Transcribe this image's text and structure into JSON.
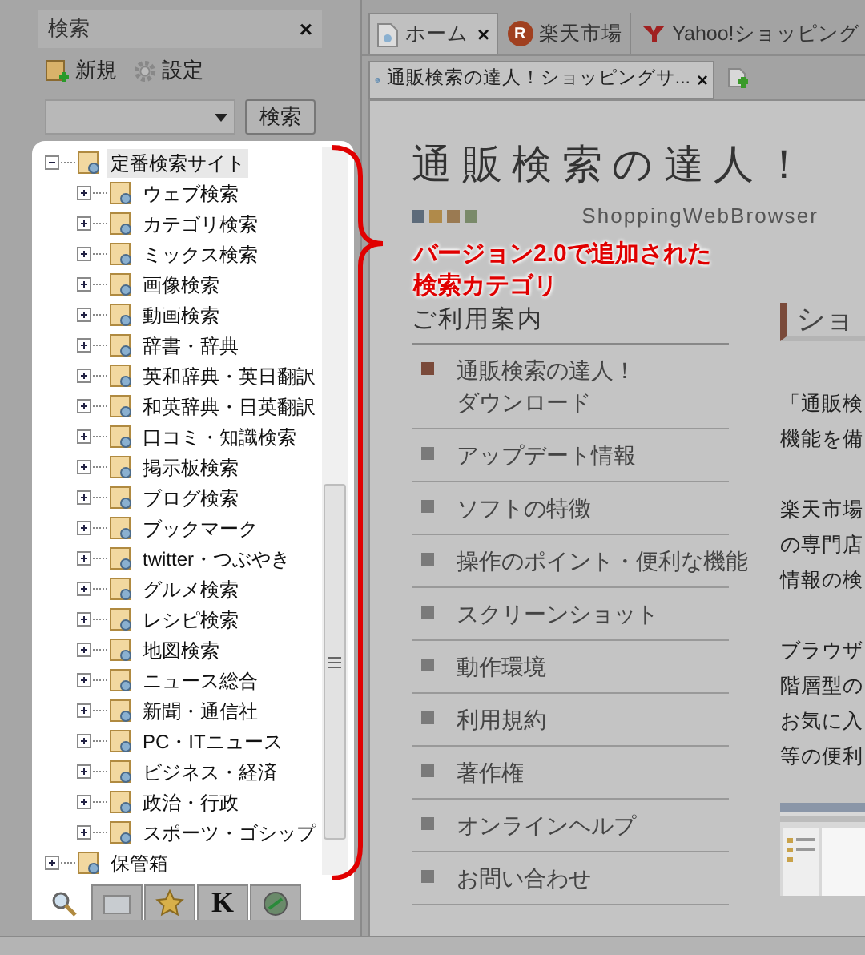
{
  "sidebar": {
    "title": "検索",
    "close": "×",
    "toolbar": [
      {
        "label": "新規",
        "kind": "new"
      },
      {
        "label": "設定",
        "kind": "settings"
      }
    ],
    "search_button": "検索",
    "tree": [
      {
        "label": "定番検索サイト",
        "expanded": true,
        "selected": true,
        "children": [
          {
            "label": "ウェブ検索",
            "expanded": false,
            "selected": false
          },
          {
            "label": "カテゴリ検索",
            "expanded": false,
            "selected": false
          },
          {
            "label": "ミックス検索",
            "expanded": false,
            "selected": false
          },
          {
            "label": "画像検索",
            "expanded": false,
            "selected": false
          },
          {
            "label": "動画検索",
            "expanded": false,
            "selected": false
          },
          {
            "label": "辞書・辞典",
            "expanded": false,
            "selected": false
          },
          {
            "label": "英和辞典・英日翻訳",
            "expanded": false,
            "selected": false
          },
          {
            "label": "和英辞典・日英翻訳",
            "expanded": false,
            "selected": false
          },
          {
            "label": "口コミ・知識検索",
            "expanded": false,
            "selected": false
          },
          {
            "label": "掲示板検索",
            "expanded": false,
            "selected": false
          },
          {
            "label": "ブログ検索",
            "expanded": false,
            "selected": false
          },
          {
            "label": "ブックマーク",
            "expanded": false,
            "selected": false
          },
          {
            "label": "twitter・つぶやき",
            "expanded": false,
            "selected": false
          },
          {
            "label": "グルメ検索",
            "expanded": false,
            "selected": false
          },
          {
            "label": "レシピ検索",
            "expanded": false,
            "selected": false
          },
          {
            "label": "地図検索",
            "expanded": false,
            "selected": false
          },
          {
            "label": "ニュース総合",
            "expanded": false,
            "selected": false
          },
          {
            "label": "新聞・通信社",
            "expanded": false,
            "selected": false
          },
          {
            "label": "PC・ITニュース",
            "expanded": false,
            "selected": false
          },
          {
            "label": "ビジネス・経済",
            "expanded": false,
            "selected": false
          },
          {
            "label": "政治・行政",
            "expanded": false,
            "selected": false
          },
          {
            "label": "スポーツ・ゴシップ",
            "expanded": false,
            "selected": false
          }
        ]
      },
      {
        "label": "保管箱",
        "expanded": false,
        "selected": false
      }
    ],
    "bottom_tabs": [
      {
        "kind": "search",
        "selected": true
      },
      {
        "kind": "folder",
        "selected": false
      },
      {
        "kind": "star",
        "selected": false
      },
      {
        "kind": "letter",
        "label": "K",
        "selected": false
      },
      {
        "kind": "globe",
        "selected": false
      }
    ]
  },
  "tabs": [
    {
      "label": "ホーム",
      "kind": "home",
      "selected": true,
      "close": "×"
    },
    {
      "label": "楽天市場",
      "kind": "rakuten",
      "icon_text": "R",
      "selected": false
    },
    {
      "label": "Yahoo!ショッピング",
      "kind": "yahoo",
      "selected": false
    }
  ],
  "page_tab": {
    "label": "通販検索の達人！ショッピングサ...",
    "close": "×"
  },
  "page": {
    "title": "通販検索の達人！",
    "subtitle": "ShoppingWebBrowser",
    "menu_heading": "ご利用案内",
    "menu": [
      {
        "lines": [
          "通販検索の達人！",
          "ダウンロード"
        ],
        "selected": true
      },
      {
        "lines": [
          "アップデート情報"
        ],
        "selected": false
      },
      {
        "lines": [
          "ソフトの特徴"
        ],
        "selected": false
      },
      {
        "lines": [
          "操作のポイント・便利な機能"
        ],
        "selected": false
      },
      {
        "lines": [
          "スクリーンショット"
        ],
        "selected": false
      },
      {
        "lines": [
          "動作環境"
        ],
        "selected": false
      },
      {
        "lines": [
          "利用規約"
        ],
        "selected": false
      },
      {
        "lines": [
          "著作権"
        ],
        "selected": false
      },
      {
        "lines": [
          "オンラインヘルプ"
        ],
        "selected": false
      },
      {
        "lines": [
          "お問い合わせ"
        ],
        "selected": false
      }
    ],
    "section_heading": "ショ",
    "paragraphs": [
      [
        "「通販検",
        "機能を備"
      ],
      [
        "楽天市場",
        "の専門店",
        "情報の検"
      ],
      [
        "ブラウザ",
        "階層型の",
        "お気に入",
        "等の便利"
      ]
    ]
  },
  "annotation": {
    "lines": [
      "バージョン2.0で追加された",
      "検索カテゴリ"
    ]
  }
}
